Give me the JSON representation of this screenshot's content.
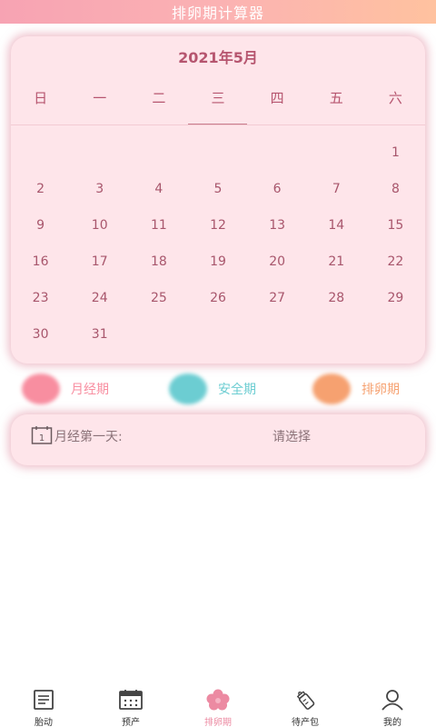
{
  "header": {
    "title": "排卵期计算器"
  },
  "calendar": {
    "month_title": "2021年5月",
    "weekdays": [
      "日",
      "一",
      "二",
      "三",
      "四",
      "五",
      "六"
    ],
    "days": [
      "",
      "",
      "",
      "",
      "",
      "",
      "1",
      "2",
      "3",
      "4",
      "5",
      "6",
      "7",
      "8",
      "9",
      "10",
      "11",
      "12",
      "13",
      "14",
      "15",
      "16",
      "17",
      "18",
      "19",
      "20",
      "21",
      "22",
      "23",
      "24",
      "25",
      "26",
      "27",
      "28",
      "29",
      "30",
      "31"
    ]
  },
  "legend": [
    {
      "label": "月经期",
      "color": "#f88ea0"
    },
    {
      "label": "安全期",
      "color": "#6ccdd2"
    },
    {
      "label": "排卵期",
      "color": "#f6a170"
    }
  ],
  "period_select": {
    "label": "月经第一天:",
    "value": "请选择",
    "icon_number": "1"
  },
  "tabbar": [
    {
      "label": "胎动",
      "icon": "clipboard-icon",
      "active": false
    },
    {
      "label": "预产",
      "icon": "calendar-icon",
      "active": false
    },
    {
      "label": "排卵期",
      "icon": "flower-icon",
      "active": true
    },
    {
      "label": "待产包",
      "icon": "baby-bottle-icon",
      "active": false
    },
    {
      "label": "我的",
      "icon": "user-icon",
      "active": false
    }
  ],
  "colors": {
    "accent": "#ec8aa2",
    "card_bg": "#fee5ea",
    "text_rose": "#b6556f"
  }
}
